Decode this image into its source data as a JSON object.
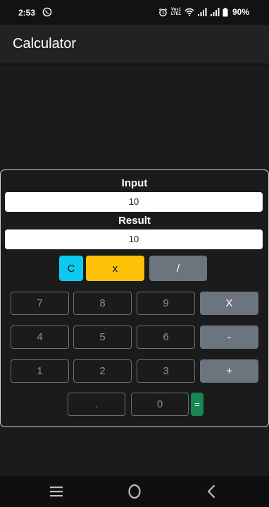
{
  "status_bar": {
    "time": "2:53",
    "network_top": "Vo»1",
    "network_bottom": "LTE1",
    "battery": "90%"
  },
  "app_bar": {
    "title": "Calculator"
  },
  "calculator": {
    "input_label": "Input",
    "input_value": "10",
    "result_label": "Result",
    "result_value": "10",
    "top_buttons": {
      "clear": "C",
      "x": "x",
      "divide": "/"
    },
    "keys": {
      "k7": "7",
      "k8": "8",
      "k9": "9",
      "multiply": "X",
      "k4": "4",
      "k5": "5",
      "k6": "6",
      "minus": "-",
      "k1": "1",
      "k2": "2",
      "k3": "3",
      "plus": "+",
      "dot": ".",
      "k0": "0",
      "equals": "="
    }
  },
  "colors": {
    "clear_button": "#0dcaf0",
    "x_button": "#ffc107",
    "operator_button": "#6c757d",
    "equals_button": "#198754"
  },
  "nav_bar": {
    "recents_icon": "recents-icon",
    "home_icon": "home-icon",
    "back_icon": "back-icon"
  }
}
